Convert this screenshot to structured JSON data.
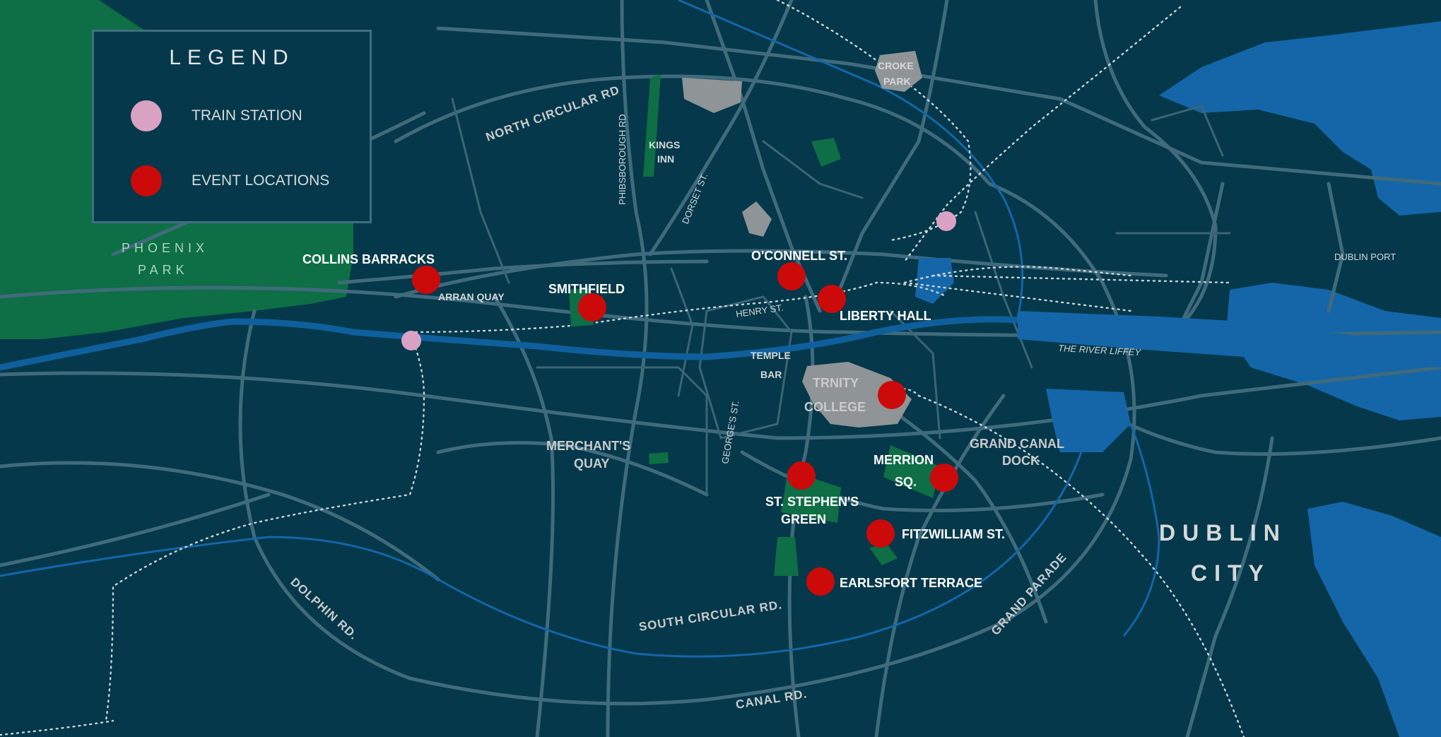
{
  "legend": {
    "title": "LEGEND",
    "items": [
      {
        "label": "TRAIN  STATION",
        "color": "#d9a2c3",
        "icon": "train-station-marker"
      },
      {
        "label": "EVENT LOCATIONS",
        "color": "#cc0a0a",
        "icon": "event-location-marker"
      }
    ]
  },
  "colors": {
    "background": "#04384a",
    "roads": "#406b7c",
    "water": "#1466a8",
    "parks": "#0e6e45",
    "buildings": "#8f9496",
    "event": "#cc0a0a",
    "station": "#d9a2c3"
  },
  "areas": {
    "phoenix_park_1": "PHOENIX",
    "phoenix_park_2": "PARK",
    "croke_park_1": "CROKE",
    "croke_park_2": "PARK",
    "kings_inn_1": "KINGS",
    "kings_inn_2": "INN",
    "temple_bar_1": "TEMPLE",
    "temple_bar_2": "BAR",
    "trinity_1": "TRNITY",
    "trinity_2": "COLLEGE",
    "merchants_quay_1": "MERCHANT'S",
    "merchants_quay_2": "QUAY",
    "grand_canal_dock_1": "GRAND CANAL",
    "grand_canal_dock_2": "DOCK",
    "dublin_port": "DUBLIN PORT",
    "river_liffey": "THE RIVER LIFFEY",
    "city_1": "DUBLIN",
    "city_2": "CITY"
  },
  "roads": {
    "north_circular": "NORTH CIRCULAR  RD",
    "phibsborough": "PHIBSBOROUGH RD",
    "dorset": "DORSET ST.",
    "henry": "HENRY ST.",
    "arran_quay": "ARRAN QUAY",
    "georges": "GEORGE'S ST.",
    "dolphin": "DOLPHIN RD.",
    "south_circular": "SOUTH CIRCULAR RD.",
    "canal": "CANAL RD.",
    "grand_parade": "GRAND PARADE"
  },
  "events": [
    {
      "name": "COLLINS BARRACKS"
    },
    {
      "name": "SMITHFIELD"
    },
    {
      "name": "O'CONNELL ST."
    },
    {
      "name": "LIBERTY HALL"
    },
    {
      "name": "TRINITY COLLEGE"
    },
    {
      "name": "MERRION SQ.",
      "label_1": "MERRION",
      "label_2": "SQ."
    },
    {
      "name": "ST. STEPHEN'S GREEN",
      "label_1": "ST. STEPHEN'S",
      "label_2": "GREEN"
    },
    {
      "name": "FITZWILLIAM ST."
    },
    {
      "name": "EARLSFORT TERRACE"
    }
  ],
  "stations": [
    "train-station-north",
    "train-station-heuston"
  ]
}
